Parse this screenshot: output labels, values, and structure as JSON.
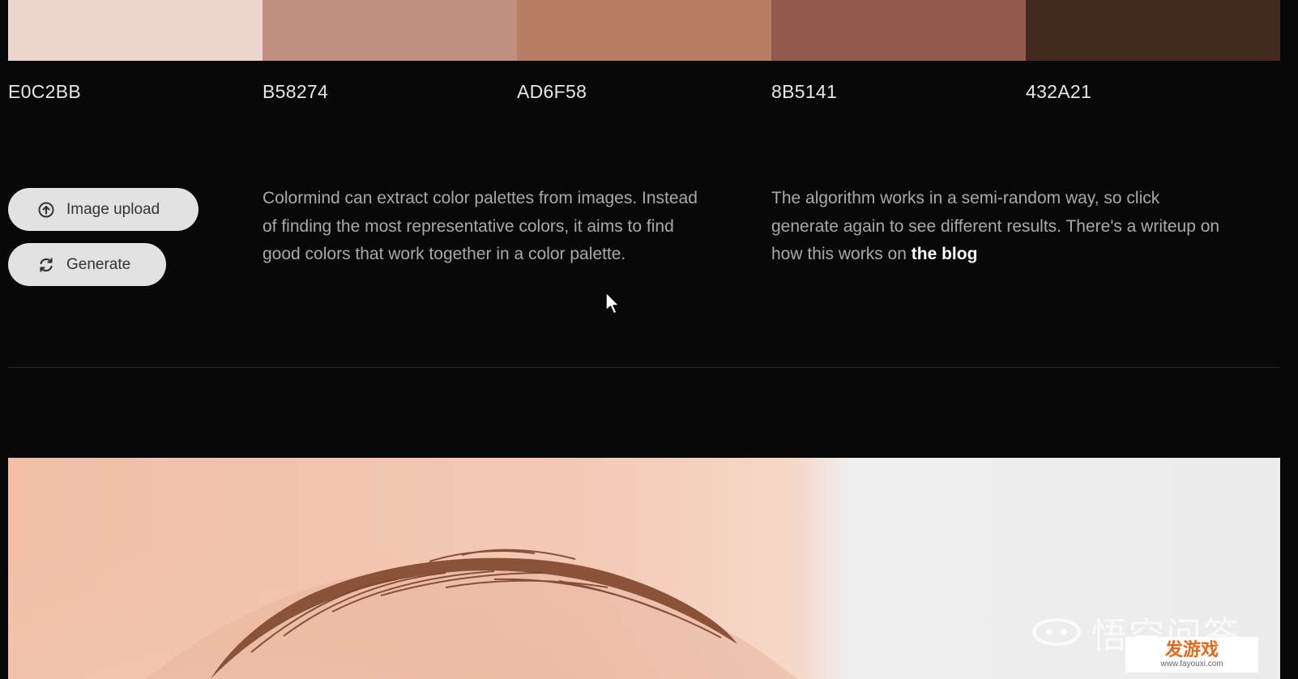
{
  "palette": {
    "colors": [
      {
        "hex": "E0C2BB",
        "color": "#ecd5cc"
      },
      {
        "hex": "B58274",
        "color": "#bf9082"
      },
      {
        "hex": "AD6F58",
        "color": "#b77d65"
      },
      {
        "hex": "8B5141",
        "color": "#93594a"
      },
      {
        "hex": "432A21",
        "color": "#432a21"
      }
    ]
  },
  "actions": {
    "upload_label": "Image upload",
    "generate_label": "Generate",
    "upload_icon": "upload-circle-icon",
    "generate_icon": "refresh-icon"
  },
  "info": {
    "description": "Colormind can extract color palettes from images. Instead of finding the most representative colors, it aims to find good colors that work together in a color palette.",
    "algorithm_text": "The algorithm works in a semi-random way, so click generate again to see different results. There's a writeup on how this works on ",
    "blog_link": "the blog"
  },
  "watermark": {
    "text": "悟空问答",
    "badge_title": "发游戏",
    "badge_url": "www.fayouxi.com"
  }
}
